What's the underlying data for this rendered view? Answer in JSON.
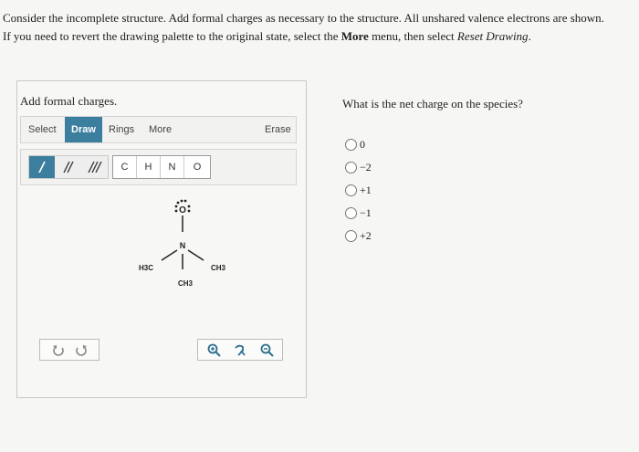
{
  "question": {
    "line1": "Consider the incomplete structure. Add formal charges as necessary to the structure. All unshared valence electrons are shown.",
    "line2_pre": "If you need to revert the drawing palette to the original state, select the ",
    "line2_bold": "More",
    "line2_mid": " menu, then select ",
    "line2_italic": "Reset Drawing",
    "line2_end": "."
  },
  "panel": {
    "title": "Add formal charges.",
    "toolbar": {
      "select": "Select",
      "draw": "Draw",
      "rings": "Rings",
      "more": "More",
      "erase": "Erase"
    },
    "atoms": [
      "C",
      "H",
      "N",
      "O"
    ],
    "bond_icons": [
      "single-bond-icon",
      "double-bond-icon",
      "triple-bond-icon"
    ]
  },
  "molecule": {
    "oxygen": "O",
    "nitrogen": "N",
    "left_group": "H3C",
    "right_group": "CH3",
    "bottom_group": "CH3"
  },
  "side": {
    "question": "What is the net charge on the species?",
    "options": [
      "0",
      "−2",
      "+1",
      "−1",
      "+2"
    ]
  },
  "colors": {
    "accent": "#3b7e9e",
    "zoom_icon": "#2b6f8f"
  }
}
